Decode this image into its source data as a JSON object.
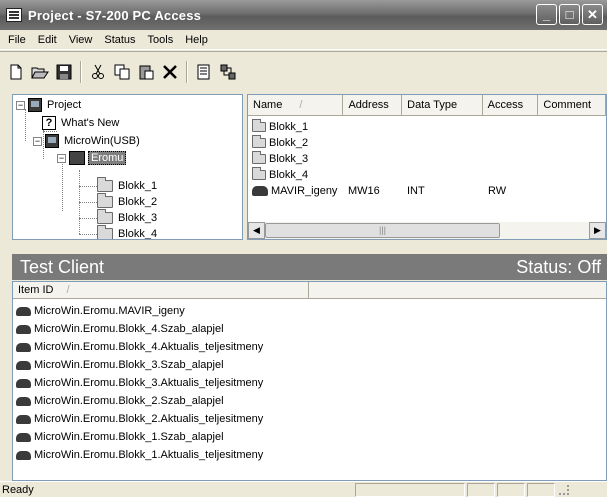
{
  "window": {
    "title": "Project - S7-200 PC Access"
  },
  "menu": [
    "File",
    "Edit",
    "View",
    "Status",
    "Tools",
    "Help"
  ],
  "toolbar": {
    "icons": [
      "new-icon",
      "open-icon",
      "save-icon",
      "cut-icon",
      "copy-icon",
      "paste-icon",
      "delete-icon",
      "properties-icon",
      "test-client-icon"
    ]
  },
  "tree": {
    "project": "Project",
    "whats_new": "What's New",
    "microwin": "MicroWin(USB)",
    "eromu": "Eromu",
    "folders": [
      "Blokk_1",
      "Blokk_2",
      "Blokk_3",
      "Blokk_4"
    ]
  },
  "list": {
    "columns": [
      "Name",
      "Address",
      "Data Type",
      "Access",
      "Comment"
    ],
    "sort_indicator": "/",
    "rows": [
      {
        "name": "Blokk_1",
        "address": "",
        "type": "",
        "access": ""
      },
      {
        "name": "Blokk_2",
        "address": "",
        "type": "",
        "access": ""
      },
      {
        "name": "Blokk_3",
        "address": "",
        "type": "",
        "access": ""
      },
      {
        "name": "Blokk_4",
        "address": "",
        "type": "",
        "access": ""
      },
      {
        "name": "MAVIR_igeny",
        "address": "MW16",
        "type": "INT",
        "access": "RW"
      }
    ]
  },
  "test_client": {
    "title": "Test Client",
    "status": "Status: Off",
    "column": "Item ID",
    "sort_indicator": "/",
    "items": [
      "MicroWin.Eromu.MAVIR_igeny",
      "MicroWin.Eromu.Blokk_4.Szab_alapjel",
      "MicroWin.Eromu.Blokk_4.Aktualis_teljesitmeny",
      "MicroWin.Eromu.Blokk_3.Szab_alapjel",
      "MicroWin.Eromu.Blokk_3.Aktualis_teljesitmeny",
      "MicroWin.Eromu.Blokk_2.Szab_alapjel",
      "MicroWin.Eromu.Blokk_2.Aktualis_teljesitmeny",
      "MicroWin.Eromu.Blokk_1.Szab_alapjel",
      "MicroWin.Eromu.Blokk_1.Aktualis_teljesitmeny"
    ]
  },
  "statusbar": {
    "text": "Ready"
  }
}
